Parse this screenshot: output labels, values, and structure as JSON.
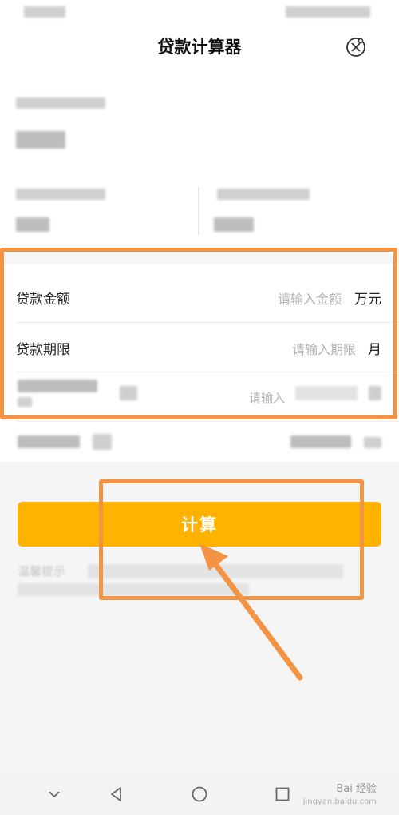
{
  "header": {
    "title": "贷款计算器",
    "close_icon": "close-circle-icon"
  },
  "form": {
    "amount": {
      "label": "贷款金额",
      "placeholder": "请输入金额",
      "unit": "万元"
    },
    "term": {
      "label": "贷款期限",
      "placeholder": "请输入期限",
      "unit": "月"
    },
    "rate": {
      "placeholder_partial": "请输入"
    }
  },
  "actions": {
    "calculate_label": "计算"
  },
  "tip": {
    "prefix_partial": "温馨提示"
  },
  "nav": {
    "icons": [
      "chevron-down-icon",
      "back-triangle-icon",
      "home-circle-icon",
      "recents-square-icon"
    ]
  },
  "watermark": {
    "text": "Bai 经验",
    "sub": "jingyan.baidu.com"
  },
  "colors": {
    "accent_button": "#ffb200",
    "highlight": "#f29444"
  }
}
